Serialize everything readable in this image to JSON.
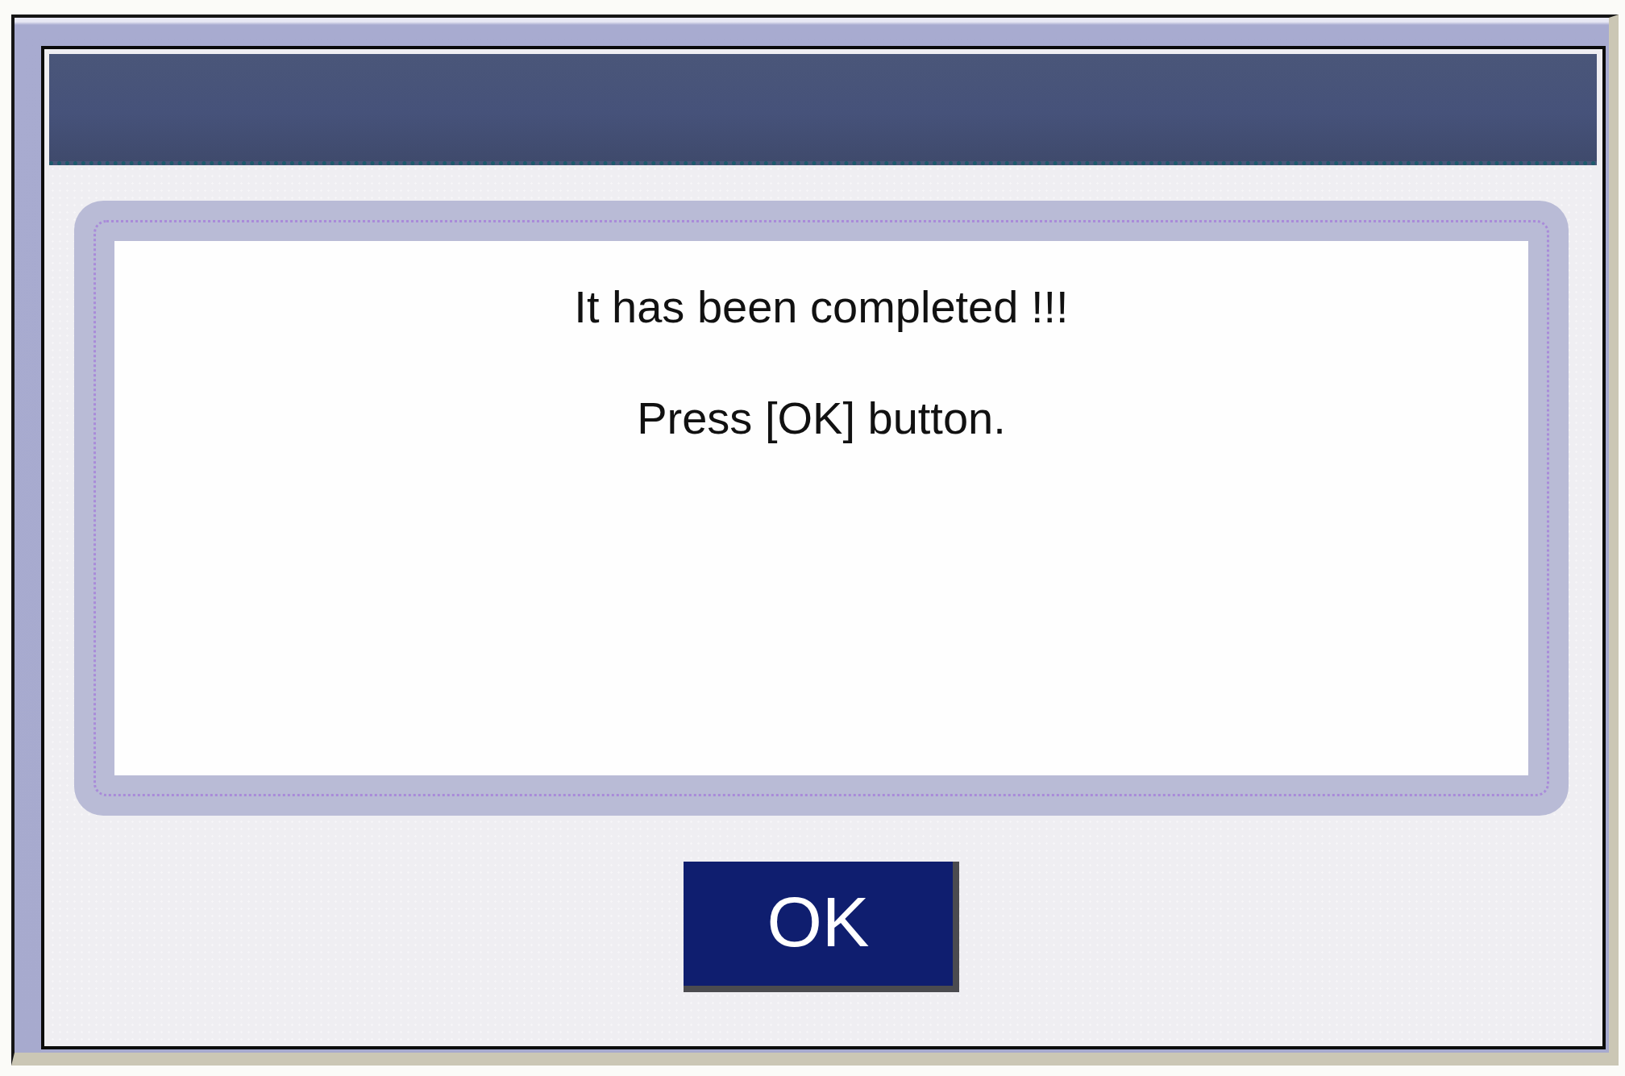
{
  "dialog": {
    "message_lines": [
      "It has been completed !!!",
      "Press [OK] button."
    ],
    "buttons": [
      "OK"
    ]
  }
}
